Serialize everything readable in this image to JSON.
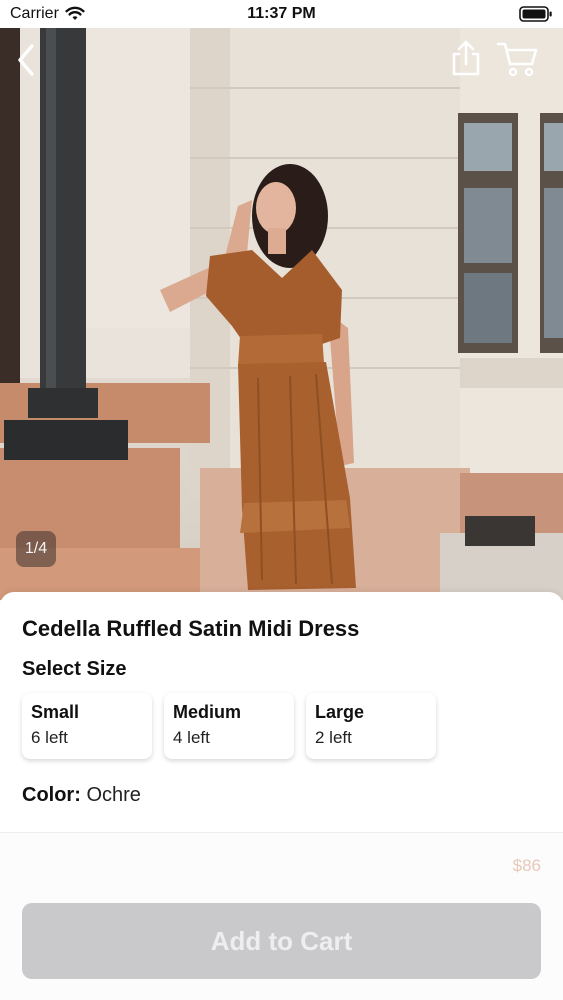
{
  "status_bar": {
    "carrier": "Carrier",
    "time": "11:37 PM"
  },
  "hero": {
    "image_counter": "1/4"
  },
  "product": {
    "title": "Cedella Ruffled Satin Midi Dress",
    "size_heading": "Select Size",
    "sizes": [
      {
        "name": "Small",
        "stock": "6 left"
      },
      {
        "name": "Medium",
        "stock": "4 left"
      },
      {
        "name": "Large",
        "stock": "2 left"
      }
    ],
    "color_label": "Color:",
    "color_value": "Ochre",
    "price": "$86"
  },
  "actions": {
    "add_to_cart": "Add to Cart"
  },
  "colors": {
    "dress": "#a8602f",
    "button_disabled": "#c9c8cb",
    "price": "#e8c8b8"
  }
}
